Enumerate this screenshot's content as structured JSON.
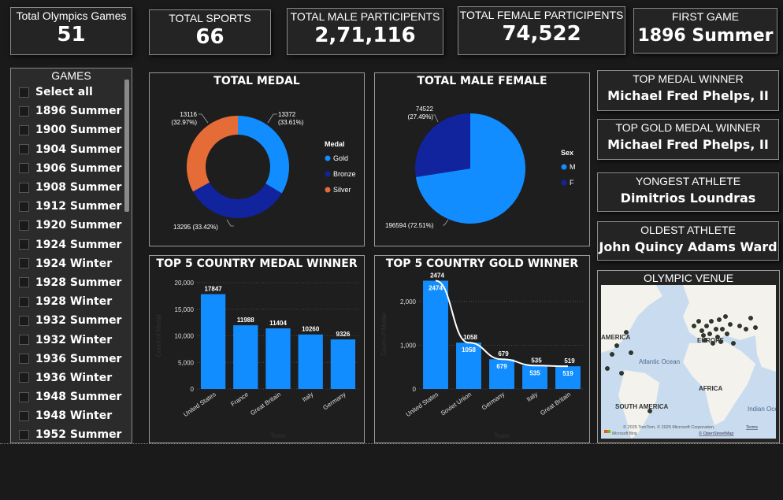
{
  "kpis": {
    "games": {
      "label": "Total Olympics Games",
      "value": "51"
    },
    "sports": {
      "label": "TOTAL SPORTS",
      "value": "66"
    },
    "male": {
      "label": "TOTAL MALE PARTICIPENTS",
      "value": "2,71,116"
    },
    "female": {
      "label": "TOTAL FEMALE PARTICIPENTS",
      "value": "74,522"
    },
    "first": {
      "label": "FIRST GAME",
      "value": "1896 Summer"
    }
  },
  "slicer": {
    "title": "GAMES",
    "items": [
      "Select all",
      "1896 Summer",
      "1900 Summer",
      "1904 Summer",
      "1906 Summer",
      "1908 Summer",
      "1912 Summer",
      "1920 Summer",
      "1924 Summer",
      "1924 Winter",
      "1928 Summer",
      "1928 Winter",
      "1932 Summer",
      "1932 Winter",
      "1936 Summer",
      "1936 Winter",
      "1948 Summer",
      "1948 Winter",
      "1952 Summer"
    ]
  },
  "info": {
    "top_medal": {
      "label": "TOP MEDAL WINNER",
      "value": "Michael Fred Phelps, II"
    },
    "top_gold": {
      "label": "TOP GOLD MEDAL WINNER",
      "value": "Michael Fred Phelps, II"
    },
    "youngest": {
      "label": "YONGEST ATHLETE",
      "value": "Dimitrios Loundras"
    },
    "oldest": {
      "label": "OLDEST ATHLETE",
      "value": "John Quincy Adams Ward"
    }
  },
  "map": {
    "title": "OLYMPIC VENUE",
    "labels": {
      "america": "AMERICA",
      "europe": "EUROPE",
      "atlantic": "Atlantic Ocean",
      "africa": "AFRICA",
      "south_america": "SOUTH AMERICA",
      "indian": "Indian Ocean"
    },
    "credit": "© 2025 TomTom, © 2025 Microsoft Corporation,",
    "terms": "Terms",
    "osm": "© OpenStreetMap",
    "bing": "Microsoft Bing"
  },
  "colors": {
    "gold": "#118dff",
    "bronze": "#12239e",
    "silver": "#e66c37",
    "bar": "#118dff",
    "line": "#ffffff"
  },
  "chart_data": [
    {
      "type": "pie",
      "title": "TOTAL MEDAL",
      "legend_title": "Medal",
      "categories": [
        "Gold",
        "Bronze",
        "Silver"
      ],
      "values": [
        13372,
        13295,
        13116
      ],
      "labels": [
        "13372\n(33.61%)",
        "13295 (33.42%)",
        "13116\n(32.97%)"
      ],
      "legend_placement": "right"
    },
    {
      "type": "pie",
      "title": "TOTAL MALE FEMALE",
      "legend_title": "Sex",
      "categories": [
        "M",
        "F"
      ],
      "values": [
        196594,
        74522
      ],
      "labels": [
        "196594 (72.51%)",
        "74522\n(27.49%)"
      ],
      "legend_placement": "right"
    },
    {
      "type": "bar",
      "title": "TOP 5 COUNTRY MEDAL WINNER",
      "categories": [
        "United States",
        "France",
        "Great Britain",
        "Italy",
        "Germany"
      ],
      "values": [
        17847,
        11988,
        11404,
        10260,
        9326
      ],
      "xlabel": "Team",
      "ylabel": "Count of Medal",
      "yticks": [
        "0",
        "5,000",
        "10,000",
        "15,000",
        "20,000"
      ],
      "ylim": [
        0,
        20000
      ]
    },
    {
      "type": "bar",
      "title": "TOP 5 COUNTRY GOLD WINNER",
      "categories": [
        "United States",
        "Soviet Union",
        "Germany",
        "Italy",
        "Great Britain"
      ],
      "values": [
        2474,
        1058,
        679,
        535,
        519
      ],
      "xlabel": "Team",
      "ylabel": "Count of Medal",
      "yticks": [
        "0",
        "1,000",
        "2,000"
      ],
      "ylim": [
        0,
        2500
      ]
    }
  ]
}
